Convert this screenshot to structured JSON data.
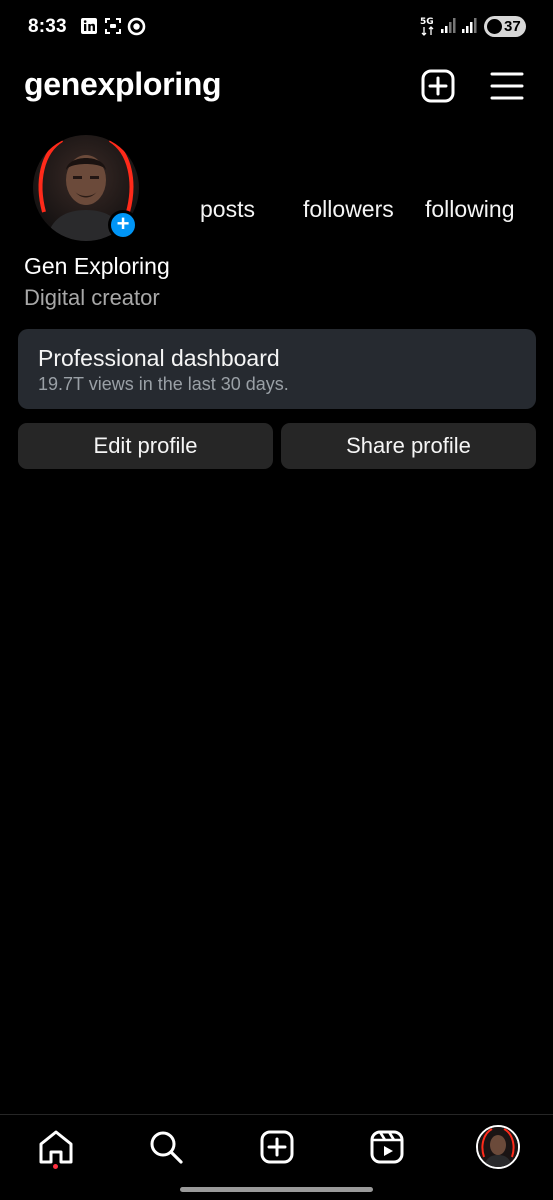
{
  "status_bar": {
    "time": "8:33",
    "network": "5G",
    "battery": "37",
    "icons": [
      "linkedin-icon",
      "screenshot-icon",
      "circle-icon",
      "signal-icon",
      "battery-icon"
    ]
  },
  "header": {
    "username": "genexploring",
    "icons": [
      "create-post-icon",
      "menu-icon"
    ]
  },
  "profile": {
    "display_name": "Gen Exploring",
    "category": "Digital creator",
    "stats": {
      "posts_label": "posts",
      "followers_label": "followers",
      "following_label": "following"
    },
    "add_story_symbol": "+"
  },
  "dashboard": {
    "title": "Professional dashboard",
    "subtitle": "19.7T views in the last 30 days."
  },
  "actions": {
    "edit_label": "Edit profile",
    "share_label": "Share profile"
  },
  "bottom_nav": {
    "items": [
      "home-icon",
      "search-icon",
      "create-icon",
      "reels-icon",
      "profile-avatar"
    ]
  },
  "colors": {
    "background": "#000000",
    "accent_blue": "#0095f6",
    "card": "#262a30",
    "button": "#262626",
    "notification_dot": "#ff3040"
  }
}
